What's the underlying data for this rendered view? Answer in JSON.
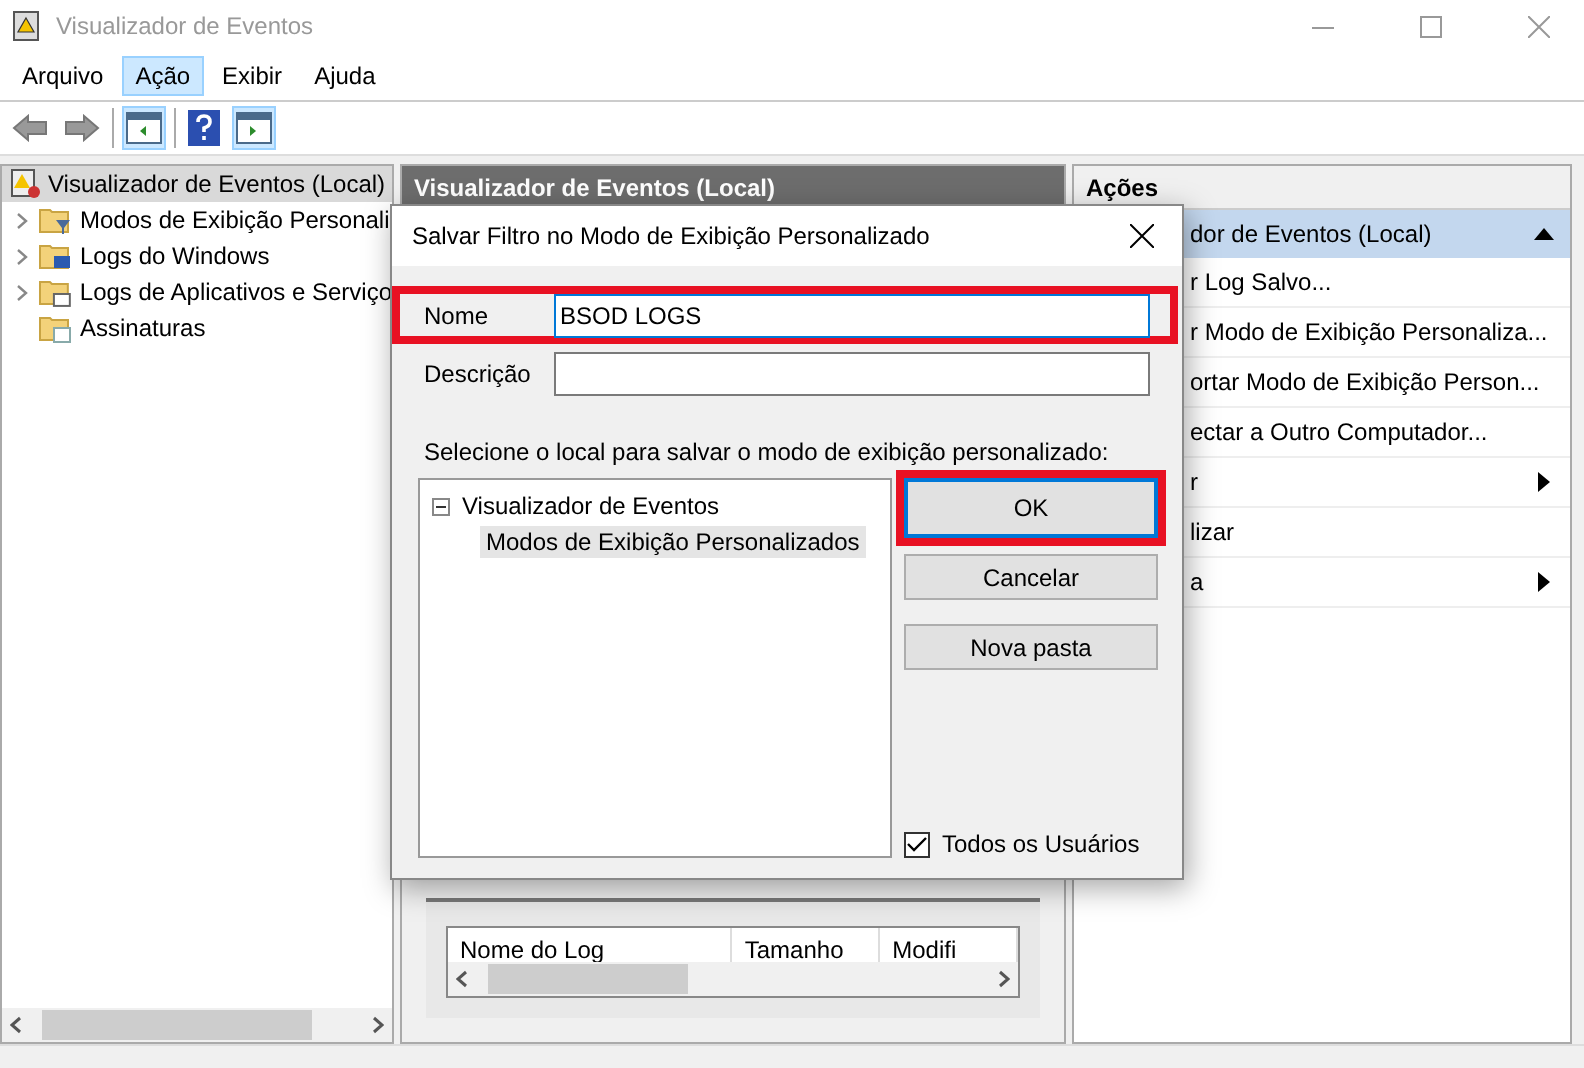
{
  "window": {
    "title": "Visualizador de Eventos"
  },
  "menu": [
    {
      "label": "Arquivo",
      "selected": false
    },
    {
      "label": "Ação",
      "selected": true
    },
    {
      "label": "Exibir",
      "selected": false
    },
    {
      "label": "Ajuda",
      "selected": false
    }
  ],
  "tree": {
    "label": "Visualizador de Eventos (Local)",
    "selected": true,
    "children": [
      {
        "label": "Modos de Exibição Personali",
        "kind": "filter"
      },
      {
        "label": "Logs do Windows",
        "kind": "computer"
      },
      {
        "label": "Logs de Aplicativos e Serviço",
        "kind": "folder"
      },
      {
        "label": "Assinaturas",
        "kind": "subscription"
      }
    ]
  },
  "middle": {
    "header": "Visualizador de Eventos (Local)",
    "columns": [
      "Nome do Log",
      "Tamanho",
      "Modifi"
    ]
  },
  "actions": {
    "header": "Ações",
    "section": {
      "label": "dor de Eventos (Local)",
      "expanded": true
    },
    "items": [
      {
        "label": "r Log Salvo...",
        "submenu": false
      },
      {
        "label": "r Modo de Exibição Personaliza...",
        "submenu": false
      },
      {
        "label": "ortar Modo de Exibição Person...",
        "submenu": false
      },
      {
        "label": "ectar a Outro Computador...",
        "submenu": false
      },
      {
        "label": "r",
        "submenu": true
      },
      {
        "label": "lizar",
        "submenu": false
      },
      {
        "label": "a",
        "submenu": true
      }
    ]
  },
  "dialog": {
    "title": "Salvar Filtro no Modo de Exibição Personalizado",
    "name_field": {
      "label": "Nome",
      "value": "BSOD LOGS",
      "highlighted": true
    },
    "description_field": {
      "label": "Descrição"
    },
    "instruction": "Selecione o local para salvar o modo de exibição personalizado:",
    "tree": {
      "label": "Visualizador de Eventos",
      "expanded": true,
      "selected": false,
      "children": [
        {
          "label": "Modos de Exibição Personalizados",
          "selected": true
        }
      ]
    },
    "buttons": [
      {
        "label": "OK",
        "highlighted": true
      },
      {
        "label": "Cancelar",
        "highlighted": false
      },
      {
        "label": "Nova pasta",
        "highlighted": false
      }
    ],
    "all_users": {
      "label": "Todos os Usuários",
      "checked": true
    }
  }
}
